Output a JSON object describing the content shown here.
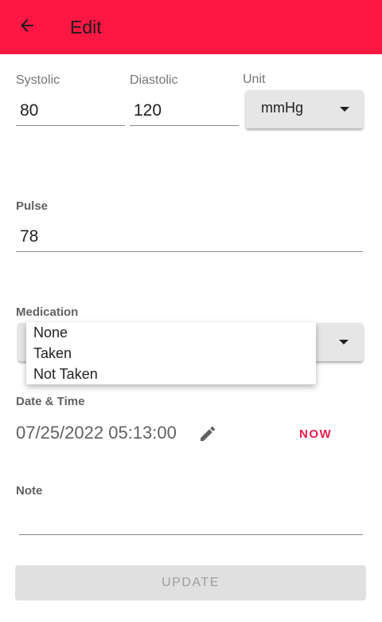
{
  "appbar": {
    "title": "Edit",
    "color": "#ff1744",
    "back_icon": "arrow-left-icon"
  },
  "reading": {
    "systolic_label": "Systolic",
    "systolic_value": "80",
    "diastolic_label": "Diastolic",
    "diastolic_value": "120",
    "unit_label": "Unit",
    "unit_value": "mmHg"
  },
  "pulse": {
    "label": "Pulse",
    "value": "78"
  },
  "medication": {
    "label": "Medication",
    "options": [
      "None",
      "Taken",
      "Not Taken"
    ]
  },
  "datetime": {
    "label": "Date & Time",
    "value": "07/25/2022 05:13:00",
    "edit_icon": "pencil-icon",
    "now_label": "NOW",
    "now_color": "#e91e4e"
  },
  "note": {
    "label": "Note",
    "value": ""
  },
  "update_button": {
    "label": "UPDATE"
  }
}
